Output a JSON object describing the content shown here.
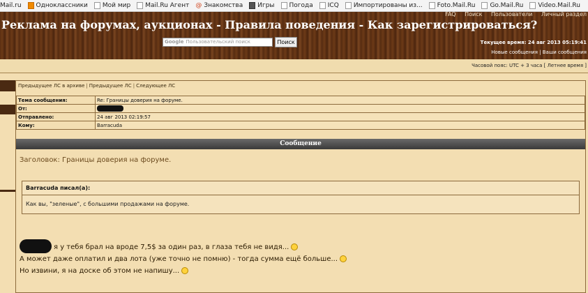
{
  "bookmarks": [
    {
      "label": "Mail.ru",
      "icon": "page-icon"
    },
    {
      "label": "Одноклассники",
      "icon": "odnoklassniki-icon"
    },
    {
      "label": "Мой мир",
      "icon": "page-icon"
    },
    {
      "label": "Mail.Ru Агент",
      "icon": "page-icon"
    },
    {
      "label": "Знакомства",
      "icon": "at-icon"
    },
    {
      "label": "Игры",
      "icon": "games-icon"
    },
    {
      "label": "Погода",
      "icon": "page-icon"
    },
    {
      "label": "ICQ",
      "icon": "page-icon"
    },
    {
      "label": "Импортированы из...",
      "icon": "page-icon"
    },
    {
      "label": "Foto.Mail.Ru",
      "icon": "page-icon"
    },
    {
      "label": "Go.Mail.Ru",
      "icon": "page-icon"
    },
    {
      "label": "Video.Mail.Ru",
      "icon": "page-icon"
    }
  ],
  "header": {
    "title": "Реклама на форумах, аукционах - Правила поведения - Как зарегистрироваться?",
    "top_links": [
      "FAQ",
      "Поиск",
      "Пользователи",
      "Личный раздел"
    ],
    "search_brand": "Google",
    "search_placeholder": "Пользовательский поиск",
    "search_button": "Поиск",
    "current_time": "Текущее время: 24 авг 2013 05:19:41",
    "new_messages": "Новые сообщения",
    "your_messages": "Ваши сообщения"
  },
  "timezone": "Часовой пояс: UTC + 3 часа [ Летнее время ]",
  "nav": {
    "prev_archive": "Предыдущее ЛС в архиве",
    "prev": "Предыдущее ЛС",
    "next": "Следующее ЛС"
  },
  "meta": {
    "subject_label": "Тема сообщения:",
    "subject_value": "Re: Границы доверия на форуме.",
    "from_label": "От:",
    "sent_label": "Отправлено:",
    "sent_value": "24 авг 2013 02:19:57",
    "to_label": "Кому:",
    "to_value": "Barracuda"
  },
  "message": {
    "heading": "Сообщение",
    "subject": "Заголовок: Границы доверия на форуме.",
    "quote_author": "Barracuda писал(а):",
    "quote_text": "Как вы, \"зеленые\", с большими продажами на форуме.",
    "line1": "я у тебя брал на вроде 7,5$ за один раз, в глаза тебя не видя...",
    "line2": "А может даже оплатил и два лота (уже точно не помню) - тогда сумма ещё больше...",
    "line3": "Но извини, я на доске об этом не напишу..."
  }
}
